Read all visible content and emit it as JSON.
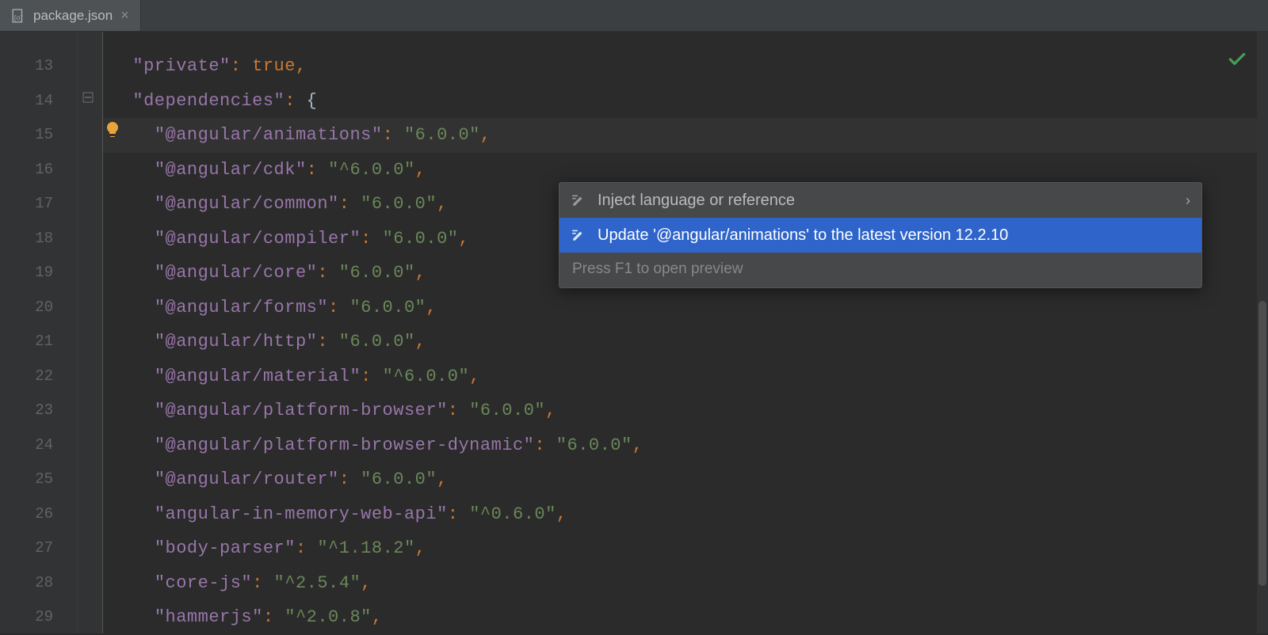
{
  "tab": {
    "label": "package.json"
  },
  "gutter": {
    "start": 13,
    "end": 29
  },
  "highlighted_line_index": 2,
  "lines": [
    {
      "indent": "  ",
      "key": "\"private\"",
      "value_type": "keyword",
      "value": "true",
      "trail": ","
    },
    {
      "indent": "  ",
      "key": "\"dependencies\"",
      "value_type": "brace",
      "value": "{",
      "trail": ""
    },
    {
      "indent": "    ",
      "key": "\"@angular/animations\"",
      "value_type": "string",
      "value": "\"6.0.0\"",
      "trail": ","
    },
    {
      "indent": "    ",
      "key": "\"@angular/cdk\"",
      "value_type": "string",
      "value": "\"^6.0.0\"",
      "trail": ","
    },
    {
      "indent": "    ",
      "key": "\"@angular/common\"",
      "value_type": "string",
      "value": "\"6.0.0\"",
      "trail": ","
    },
    {
      "indent": "    ",
      "key": "\"@angular/compiler\"",
      "value_type": "string",
      "value": "\"6.0.0\"",
      "trail": ","
    },
    {
      "indent": "    ",
      "key": "\"@angular/core\"",
      "value_type": "string",
      "value": "\"6.0.0\"",
      "trail": ","
    },
    {
      "indent": "    ",
      "key": "\"@angular/forms\"",
      "value_type": "string",
      "value": "\"6.0.0\"",
      "trail": ","
    },
    {
      "indent": "    ",
      "key": "\"@angular/http\"",
      "value_type": "string",
      "value": "\"6.0.0\"",
      "trail": ","
    },
    {
      "indent": "    ",
      "key": "\"@angular/material\"",
      "value_type": "string",
      "value": "\"^6.0.0\"",
      "trail": ","
    },
    {
      "indent": "    ",
      "key": "\"@angular/platform-browser\"",
      "value_type": "string",
      "value": "\"6.0.0\"",
      "trail": ","
    },
    {
      "indent": "    ",
      "key": "\"@angular/platform-browser-dynamic\"",
      "value_type": "string",
      "value": "\"6.0.0\"",
      "trail": ","
    },
    {
      "indent": "    ",
      "key": "\"@angular/router\"",
      "value_type": "string",
      "value": "\"6.0.0\"",
      "trail": ","
    },
    {
      "indent": "    ",
      "key": "\"angular-in-memory-web-api\"",
      "value_type": "string",
      "value": "\"^0.6.0\"",
      "trail": ","
    },
    {
      "indent": "    ",
      "key": "\"body-parser\"",
      "value_type": "string",
      "value": "\"^1.18.2\"",
      "trail": ","
    },
    {
      "indent": "    ",
      "key": "\"core-js\"",
      "value_type": "string",
      "value": "\"^2.5.4\"",
      "trail": ","
    },
    {
      "indent": "    ",
      "key": "\"hammerjs\"",
      "value_type": "string",
      "value": "\"^2.0.8\"",
      "trail": ","
    }
  ],
  "popup": {
    "items": [
      {
        "label": "Inject language or reference",
        "selected": false,
        "chevron": true
      },
      {
        "label": "Update '@angular/animations' to the latest version 12.2.10",
        "selected": true,
        "chevron": false
      }
    ],
    "footer": "Press F1 to open preview"
  }
}
